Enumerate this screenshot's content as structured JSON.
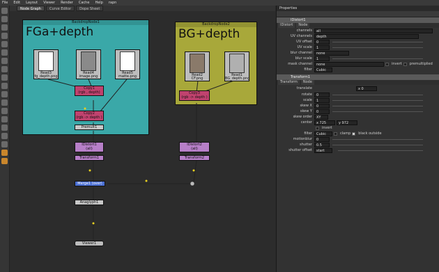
{
  "menu": [
    "File",
    "Edit",
    "Layout",
    "Viewer",
    "Render",
    "Cache",
    "Help",
    "rapn"
  ],
  "tabs": [
    "Node Graph",
    "Curve Editor",
    "Dope Sheet"
  ],
  "backdrops": [
    {
      "title": "BackdropNode1",
      "label": "FGa+depth",
      "color": "#3aa8a8"
    },
    {
      "title": "BackdropNode2",
      "label": "BG+depth",
      "color": "#a8a83a"
    }
  ],
  "nodes": {
    "read3": "Read3\nfg_depth.png",
    "read4": "Read4\nimage.png",
    "read5": "Read5\nmatte.png",
    "read2": "Read2\nCF.png",
    "read1": "Read1\nBG_depth.png",
    "copy1": "Copy1",
    "copy1_sub": "(rgb , depth)",
    "copy2": "Copy2",
    "copy2_sub": "(rgb -> depth )",
    "premult": "Premult1",
    "copy3": "Copy3",
    "copy3_sub": "(rgb -> depth )",
    "idistort1": "IDistort1",
    "idistort1_sub": "(all)",
    "transform1": "Transform1",
    "idistort2": "IDistort2",
    "idistort2_sub": "(all)",
    "transform2": "Transform2",
    "merge": "Merge1 (over)",
    "anaglyph": "Anaglyph1",
    "viewer": "Viewer1"
  },
  "properties": {
    "header": "Properties",
    "idistort": {
      "name": "IDistort1",
      "tabs": [
        "IDistort",
        "Node"
      ],
      "rows": [
        {
          "label": "channels",
          "value": "all"
        },
        {
          "label": "UV channels",
          "value": "depth"
        },
        {
          "label": "UV offset",
          "value": "0"
        },
        {
          "label": "UV scale",
          "value": "1"
        },
        {
          "label": "blur channel",
          "value": "none"
        },
        {
          "label": "blur scale",
          "value": "1"
        },
        {
          "label": "mask channel",
          "value": "none"
        },
        {
          "label": "filter",
          "value": "Cubic"
        }
      ],
      "invert": "invert",
      "premultiplied": "premultiplied"
    },
    "transform": {
      "name": "Transform1",
      "tabs": [
        "Transform",
        "Node"
      ],
      "rows": [
        {
          "label": "translate",
          "value": "x 0"
        },
        {
          "label": "rotate",
          "value": "0"
        },
        {
          "label": "scale",
          "value": "1"
        },
        {
          "label": "skew X",
          "value": "0"
        },
        {
          "label": "skew Y",
          "value": "0"
        },
        {
          "label": "skew order",
          "value": "XY"
        },
        {
          "label": "center",
          "value": "x 725"
        },
        {
          "label": "",
          "value": "invert"
        },
        {
          "label": "filter",
          "value": "Cubic"
        },
        {
          "label": "motionblur",
          "value": "0"
        },
        {
          "label": "shutter",
          "value": "0.5"
        },
        {
          "label": "shutter offset",
          "value": "start"
        }
      ],
      "center_y": "y 972",
      "clamp": "clamp",
      "black_outside": "black outside"
    }
  }
}
